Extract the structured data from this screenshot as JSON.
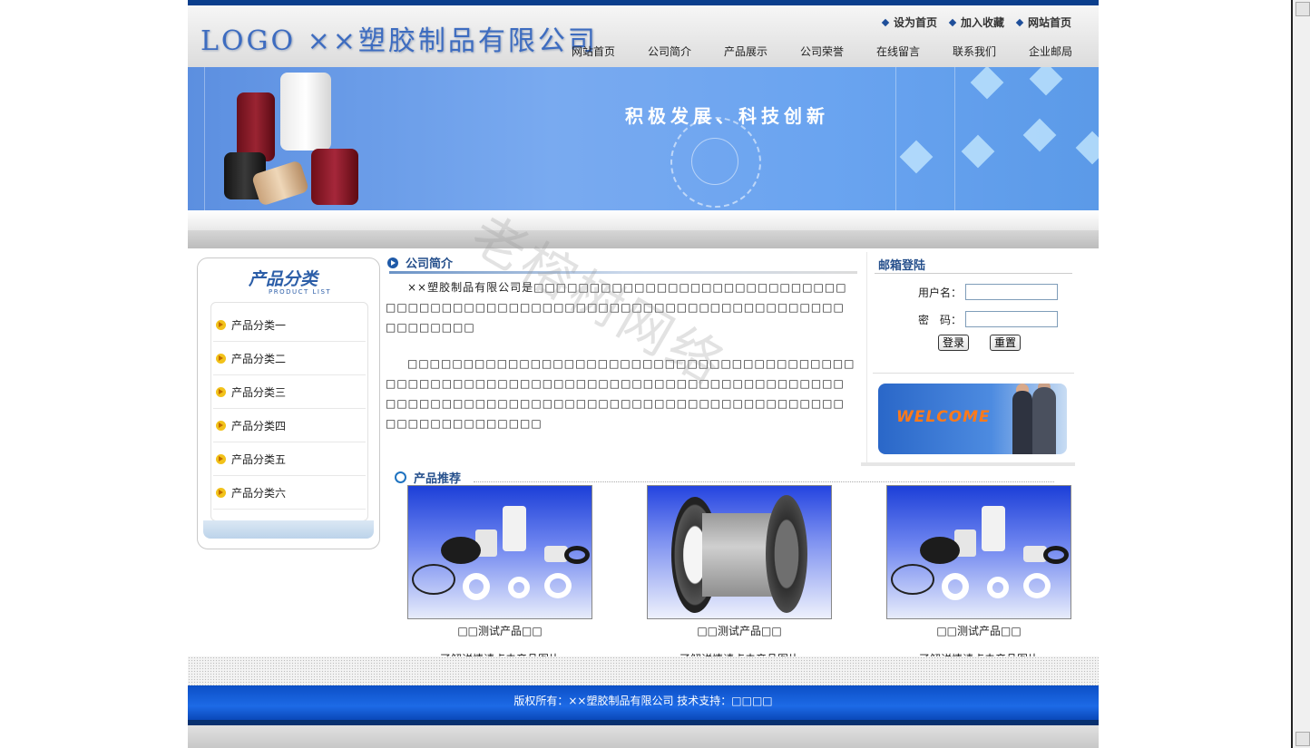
{
  "header": {
    "logo": "LOGO ××塑胶制品有限公司",
    "top_links": [
      "设为首页",
      "加入收藏",
      "网站首页"
    ],
    "nav": [
      "网站首页",
      "公司简介",
      "产品展示",
      "公司荣誉",
      "在线留言",
      "联系我们",
      "企业邮局"
    ]
  },
  "banner": {
    "slogan": "积极发展、科技创新"
  },
  "sidebar": {
    "title": "产品分类",
    "subtitle": "PRODUCT LIST",
    "items": [
      "产品分类一",
      "产品分类二",
      "产品分类三",
      "产品分类四",
      "产品分类五",
      "产品分类六"
    ]
  },
  "about": {
    "title": "公司简介",
    "paragraphs": [
      "××塑胶制品有限公司是□□□□□□□□□□□□□□□□□□□□□□□□□□□□□□□□□□□□□□□□□□□□□□□□□□□□□□□□□□□□□□□□□□□□□□□□□□□□□",
      "□□□□□□□□□□□□□□□□□□□□□□□□□□□□□□□□□□□□□□□□□□□□□□□□□□□□□□□□□□□□□□□□□□□□□□□□□□□□□□□□□□□□□□□□□□□□□□□□□□□□□□□□□□□□□□□□□□□□□□□□□□□□□□□□□□□□□□□□"
    ]
  },
  "mail_login": {
    "title": "邮箱登陆",
    "username_label": "用户名：",
    "password_label": "密　码：",
    "username_value": "",
    "password_value": "",
    "login_button": "登录",
    "reset_button": "重置",
    "welcome_text": "WELCOME"
  },
  "products": {
    "title": "产品推荐",
    "items": [
      {
        "name": "□□测试产品□□",
        "tip": "了解详情请点击产品图片",
        "image": "ptfe-parts"
      },
      {
        "name": "□□测试产品□□",
        "tip": "了解详情请点击产品图片",
        "image": "lined-pipe"
      },
      {
        "name": "□□测试产品□□",
        "tip": "了解详情请点击产品图片",
        "image": "ptfe-parts"
      }
    ]
  },
  "footer": {
    "copyright": "版权所有：××塑胶制品有限公司  技术支持：□□□□"
  },
  "watermark": "老榕树网络",
  "colors": {
    "brand_blue": "#0a3e8c",
    "title_blue": "#26508c",
    "footer_blue": "#1d6ae6"
  }
}
